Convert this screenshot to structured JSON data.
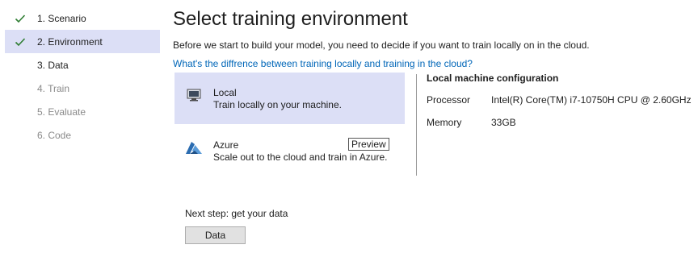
{
  "steps": [
    {
      "label": "1. Scenario",
      "state": "done"
    },
    {
      "label": "2. Environment",
      "state": "active"
    },
    {
      "label": "3. Data",
      "state": "enabled"
    },
    {
      "label": "4. Train",
      "state": "disabled"
    },
    {
      "label": "5. Evaluate",
      "state": "disabled"
    },
    {
      "label": "6. Code",
      "state": "disabled"
    }
  ],
  "page": {
    "title": "Select training environment",
    "intro": "Before we start to build your model, you need to decide if you want to train locally on in the cloud.",
    "diff_link": "What's the diffrence between training locally and training in the cloud?"
  },
  "options": {
    "local": {
      "name": "Local",
      "desc": "Train locally on your machine.",
      "icon": "monitor-icon",
      "selected": true
    },
    "azure": {
      "name": "Azure",
      "desc": "Scale out to the cloud and train in Azure.",
      "icon": "azure-icon",
      "badge": "Preview",
      "selected": false
    }
  },
  "config": {
    "title": "Local machine configuration",
    "rows": [
      {
        "key": "Processor",
        "value": "Intel(R) Core(TM) i7-10750H CPU @ 2.60GHz"
      },
      {
        "key": "Memory",
        "value": "33GB"
      }
    ]
  },
  "footer": {
    "next_step": "Next step: get your data",
    "button": "Data"
  },
  "colors": {
    "accent_selected_bg": "#dcdff6",
    "check_green": "#2e7d32",
    "link_blue": "#0066b8",
    "azure_blue": "#2b6cb0"
  }
}
